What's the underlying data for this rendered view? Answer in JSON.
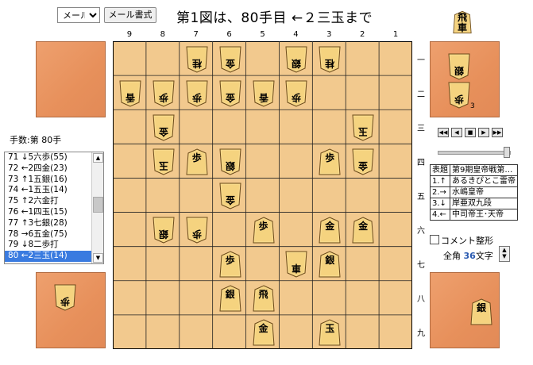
{
  "toolbar": {
    "mail_select_value": "メール出力",
    "mail_format_label": "メール書式"
  },
  "title": "第1図は、80手目 ←２三玉まで",
  "board": {
    "file_labels": [
      "9",
      "8",
      "7",
      "6",
      "5",
      "4",
      "3",
      "2",
      "1"
    ],
    "rank_labels": [
      "一",
      "二",
      "三",
      "四",
      "五",
      "六",
      "七",
      "八",
      "九"
    ],
    "pieces": [
      {
        "file": 7,
        "rank": 1,
        "char": "桂",
        "owner": "gote"
      },
      {
        "file": 6,
        "rank": 1,
        "char": "金",
        "owner": "gote"
      },
      {
        "file": 4,
        "rank": 1,
        "char": "銀",
        "owner": "gote"
      },
      {
        "file": 3,
        "rank": 1,
        "char": "桂",
        "owner": "gote"
      },
      {
        "file": 9,
        "rank": 2,
        "char": "香",
        "owner": "gote"
      },
      {
        "file": 8,
        "rank": 2,
        "char": "歩",
        "owner": "gote"
      },
      {
        "file": 7,
        "rank": 2,
        "char": "歩",
        "owner": "gote"
      },
      {
        "file": 6,
        "rank": 2,
        "char": "金",
        "owner": "gote"
      },
      {
        "file": 5,
        "rank": 2,
        "char": "香",
        "owner": "gote"
      },
      {
        "file": 4,
        "rank": 2,
        "char": "歩",
        "owner": "gote"
      },
      {
        "file": 8,
        "rank": 3,
        "char": "金",
        "owner": "gote"
      },
      {
        "file": 2,
        "rank": 3,
        "char": "玉",
        "owner": "gote"
      },
      {
        "file": 8,
        "rank": 4,
        "char": "玉",
        "owner": "gote"
      },
      {
        "file": 7,
        "rank": 4,
        "char": "歩",
        "owner": "sente"
      },
      {
        "file": 6,
        "rank": 4,
        "char": "銀",
        "owner": "gote"
      },
      {
        "file": 3,
        "rank": 4,
        "char": "歩",
        "owner": "sente"
      },
      {
        "file": 2,
        "rank": 4,
        "char": "金",
        "owner": "gote"
      },
      {
        "file": 6,
        "rank": 5,
        "char": "金",
        "owner": "gote"
      },
      {
        "file": 8,
        "rank": 6,
        "char": "銀",
        "owner": "gote"
      },
      {
        "file": 7,
        "rank": 6,
        "char": "歩",
        "owner": "gote"
      },
      {
        "file": 5,
        "rank": 6,
        "char": "歩",
        "owner": "sente"
      },
      {
        "file": 3,
        "rank": 6,
        "char": "金",
        "owner": "sente"
      },
      {
        "file": 2,
        "rank": 6,
        "char": "金",
        "owner": "sente"
      },
      {
        "file": 6,
        "rank": 7,
        "char": "歩",
        "owner": "sente"
      },
      {
        "file": 4,
        "rank": 7,
        "char": "車",
        "owner": "gote"
      },
      {
        "file": 3,
        "rank": 7,
        "char": "銀",
        "owner": "sente"
      },
      {
        "file": 6,
        "rank": 8,
        "char": "銀",
        "owner": "sente"
      },
      {
        "file": 5,
        "rank": 8,
        "char": "飛",
        "owner": "sente"
      },
      {
        "file": 5,
        "rank": 9,
        "char": "金",
        "owner": "sente"
      },
      {
        "file": 3,
        "rank": 9,
        "char": "玉",
        "owner": "sente"
      }
    ]
  },
  "gote_hand_top": {
    "top": "飛",
    "bottom": "車"
  },
  "gote_hand_pieces": [
    {
      "char": "銀"
    },
    {
      "char": "歩",
      "count": "3"
    }
  ],
  "sente_hand_pieces": [
    {
      "char": "銀"
    }
  ],
  "gote_bottom_hand_pieces": [
    {
      "char": "歩"
    }
  ],
  "move_count_label": "手数:第 80手",
  "move_list": [
    "71 ↓5六歩(55)",
    "72 ←2四金(23)",
    "73 ↑1五銀(16)",
    "74 ←1五玉(14)",
    "75 ↑2六金打",
    "76 ←1四玉(15)",
    "77 ↑3七銀(28)",
    "78 →6五金(75)",
    "79 ↓8二歩打",
    "80 ←2三玉(14)"
  ],
  "selected_move_index": 9,
  "nav_buttons": [
    "first",
    "prev",
    "stop",
    "next",
    "last"
  ],
  "info_table": [
    [
      "表題",
      "第9期皇帝戦第…"
    ],
    [
      "1.↑",
      "あるきぴとこ雷帝"
    ],
    [
      "2.→",
      "水嶋皇帝"
    ],
    [
      "3.↓",
      "岸亜双九段"
    ],
    [
      "4.←",
      "中司帝王･天帝"
    ]
  ],
  "comment_label": "コメント整形",
  "zenkaku": {
    "prefix": "全角",
    "count": "36",
    "suffix": "文字"
  }
}
